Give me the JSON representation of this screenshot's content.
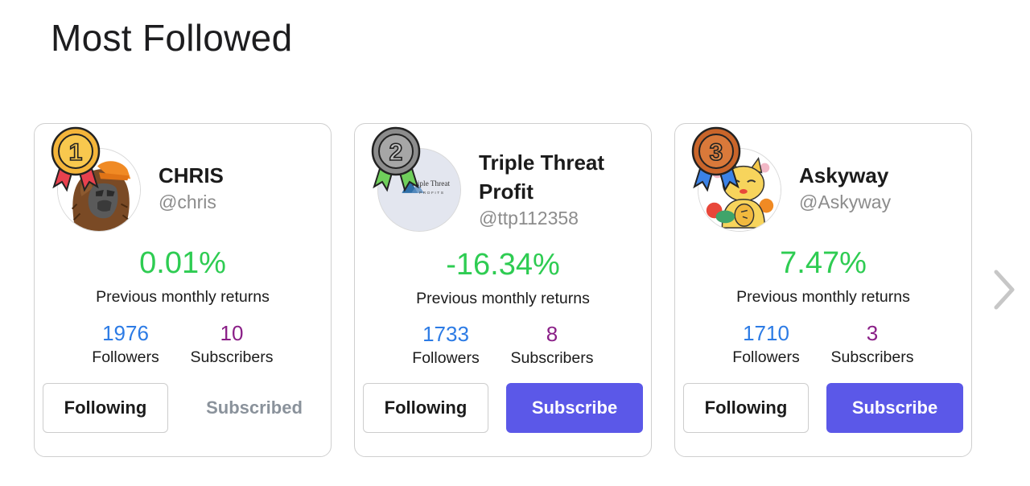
{
  "page": {
    "title": "Most Followed"
  },
  "colors": {
    "positive_return": "#2ecc52",
    "followers_count": "#2c7be5",
    "subscribers_count": "#8a1f87",
    "subscribe_button": "#5b58e8",
    "subscribed_text": "#8a929b"
  },
  "cards": [
    {
      "rank": "1",
      "medal": "gold-medal-icon",
      "name": "CHRIS",
      "handle": "@chris",
      "return_value": "0.01%",
      "return_label": "Previous monthly returns",
      "followers": "1976",
      "followers_label": "Followers",
      "subscribers": "10",
      "subscribers_label": "Subscribers",
      "follow_button": "Following",
      "subscribe_button": "Subscribed"
    },
    {
      "rank": "2",
      "medal": "silver-medal-icon",
      "name": "Triple Threat Profit",
      "handle": "@ttp112358",
      "avatar_text": "Triple Threat",
      "avatar_subtext": "PROFITS",
      "return_value": "-16.34%",
      "return_label": "Previous monthly returns",
      "followers": "1733",
      "followers_label": "Followers",
      "subscribers": "8",
      "subscribers_label": "Subscribers",
      "follow_button": "Following",
      "subscribe_button": "Subscribe"
    },
    {
      "rank": "3",
      "medal": "bronze-medal-icon",
      "name": "Askyway",
      "handle": "@Askyway",
      "return_value": "7.47%",
      "return_label": "Previous monthly returns",
      "followers": "1710",
      "followers_label": "Followers",
      "subscribers": "3",
      "subscribers_label": "Subscribers",
      "follow_button": "Following",
      "subscribe_button": "Subscribe"
    }
  ],
  "carousel": {
    "next_icon": "chevron-right-icon"
  }
}
